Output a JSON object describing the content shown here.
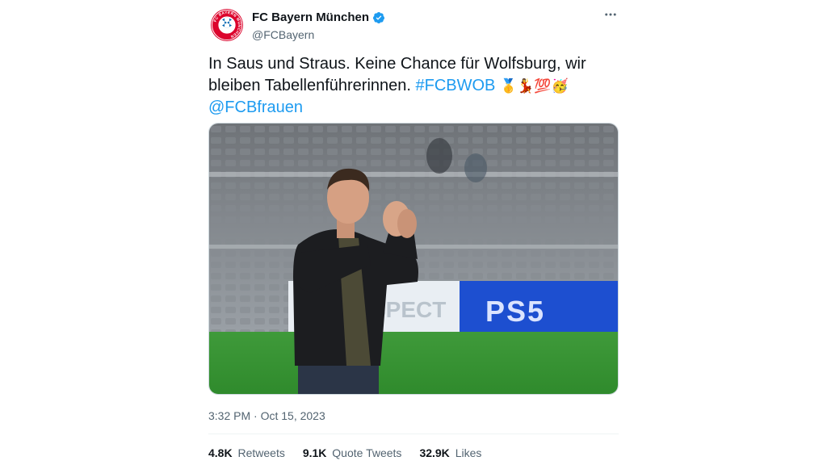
{
  "author": {
    "display_name": "FC Bayern München",
    "handle": "@FCBayern",
    "avatar_icon": "fc-bayern-crest-icon",
    "avatar_crest_text": "FC BAYERN MÜNCHEN",
    "verified_icon": "verified-badge-icon",
    "verified_color": "#1d9bf0"
  },
  "more_icon": "more-horizontal-icon",
  "tweet": {
    "text_part1": "In Saus und Straus. Keine Chance für Wolfsburg, wir bleiben Tabellenführerinnen.",
    "hashtag": "#FCBWOB",
    "emojis": "🥇💃💯🥳",
    "mention": "@FCBfrauen",
    "link_color": "#1d9bf0"
  },
  "media": {
    "type": "photo",
    "icon": "photo-man-applauding-in-stadium",
    "sign_text_left": "SPECT",
    "sign_text_right": "PS5"
  },
  "timestamp": "3:32 PM · Oct 15, 2023",
  "stats": {
    "retweets_count": "4.8K",
    "retweets_label": "Retweets",
    "quotes_count": "9.1K",
    "quotes_label": "Quote Tweets",
    "likes_count": "32.9K",
    "likes_label": "Likes"
  }
}
